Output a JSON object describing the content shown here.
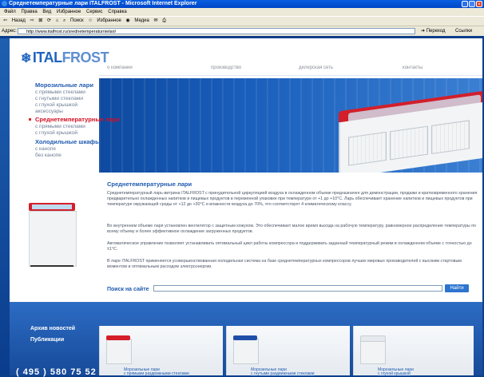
{
  "browser": {
    "title": "Среднетемпературные лари ITALFROST - Microsoft Internet Explorer",
    "menu": [
      "Файл",
      "Правка",
      "Вид",
      "Избранное",
      "Сервис",
      "Справка"
    ],
    "toolbar": [
      "Назад",
      "Поиск",
      "Избранное",
      "Медиа"
    ],
    "address_label": "Адрес:",
    "address_value": "http://www.italfrost.ru/srednetemperaturnielari/",
    "go_label": "Переход",
    "links_label": "Ссылки"
  },
  "site": {
    "logo_a": "ITAL",
    "logo_b": "FROST",
    "topnav": [
      "о компании",
      "производство",
      "дилерская сеть",
      "контакты"
    ],
    "leftnav": {
      "cat1": "Морозильные лари",
      "cat1_subs": [
        "с прямыми стеклами",
        "с гнутыми стеклами",
        "с глухой крышкой",
        "аксессуары"
      ],
      "cat2": "Среднетемпературные лари",
      "cat2_subs": [
        "с прямыми стеклами",
        "с глухой крышкой"
      ],
      "cat3": "Холодильные шкафы",
      "cat3_subs": [
        "с канопе",
        "без канопе"
      ]
    },
    "content": {
      "title": "Среднетемпературные лари",
      "p1": "Среднетемпературный ларь-витрина ITALFROST с принудительной циркуляцией воздуха в охлажденном объеме предназначен для демонстрации, продажи и кратковременного хранения предварительно охлажденных напитков и пищевых продуктов в переменной упаковке при температуре от +1 до +10°С. Ларь обеспечивает хранение напитков и пищевых продуктов при температуре окружающей среды от +12 до +30°С и влажности воздуха до 70%, что соответствует 4 климатическому классу.",
      "p2": "Во внутреннем объеме ларя установлен вентилятор с защитным кожухом. Это обеспечивает малое время выхода на рабочую температуру, равномерное распределение температуры по всему объему и более эффективное охлаждение загруженных продуктов.",
      "p3": "Автоматическое управление позволяет устанавливать оптимальный цикл работы компрессора и поддерживать заданный температурный режим в охлажденном объеме с точностью до ±1°С.",
      "p4": "В ларе ITALFROST применяется усовершенствованная холодильная система на базе среднетемпературных компрессоров лучших мировых производителей с высоким стартовым моментом и оптимальным расходом электроэнергии."
    },
    "search": {
      "label": "Поиск на сайте",
      "button": "Найти"
    },
    "footer": {
      "news": "Архив новостей",
      "pubs": "Публикации",
      "phone": "( 495 )   580 75 52",
      "thumbs": [
        {
          "line1": "Морозильные лари",
          "line2": "с прямыми раздвижными стеклами",
          "lid_color": "#d41f2a"
        },
        {
          "line1": "Морозильные лари",
          "line2": "с гнутыми раздвижными стеклами",
          "lid_color": "#1f4fa8"
        },
        {
          "line1": "Морозильные лари",
          "line2": "с глухой крышкой",
          "lid_color": "#e6e9ee"
        }
      ]
    }
  }
}
